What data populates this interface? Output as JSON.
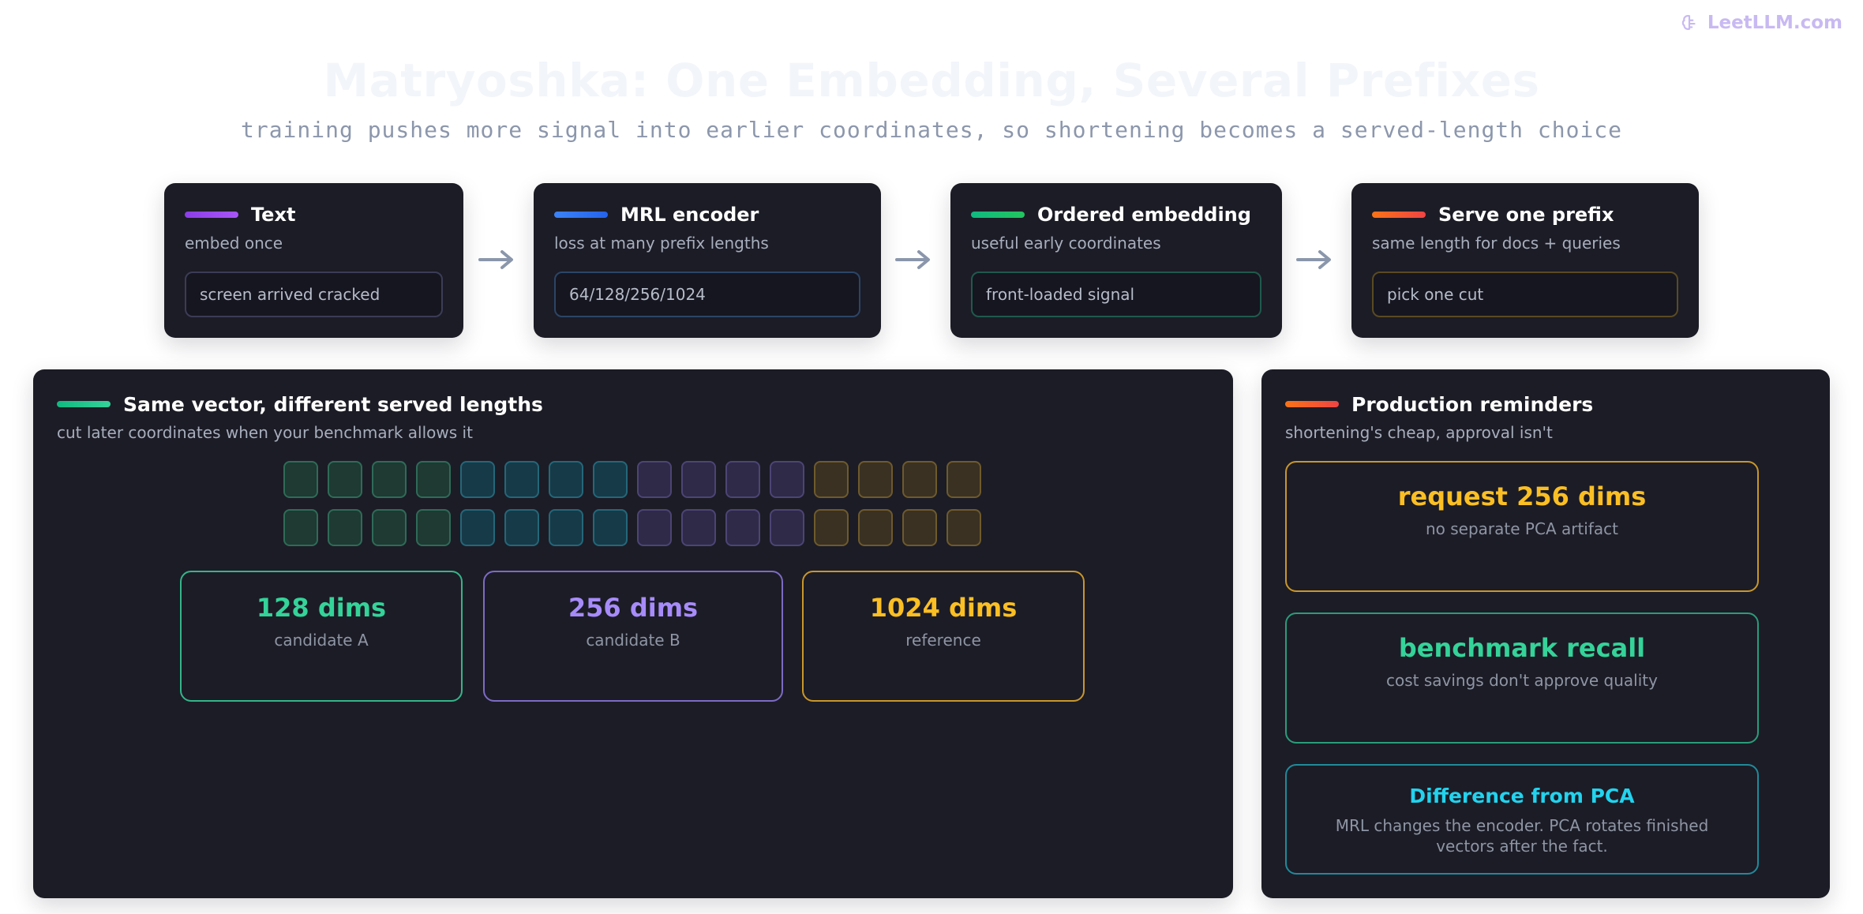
{
  "brand": {
    "name": "LeetLLM.com"
  },
  "title": "Matryoshka: One Embedding, Several Prefixes",
  "subtitle": "training pushes more signal into earlier coordinates, so shortening becomes a served-length choice",
  "pipeline": [
    {
      "title": "Text",
      "subtitle": "embed once",
      "box": "screen arrived cracked",
      "accent": "#8b3ee6",
      "accent2": "#a855f7"
    },
    {
      "title": "MRL encoder",
      "subtitle": "loss at many prefix lengths",
      "box": "64/128/256/1024",
      "accent": "#3b82f6",
      "accent2": "#2563eb"
    },
    {
      "title": "Ordered embedding",
      "subtitle": "useful early coordinates",
      "box": "front-loaded signal",
      "accent": "#10b981",
      "accent2": "#22c55e"
    },
    {
      "title": "Serve one prefix",
      "subtitle": "same length for docs + queries",
      "box": "pick one cut",
      "accent": "#f97316",
      "accent2": "#ef4444"
    }
  ],
  "left_panel": {
    "title": "Same vector, different served lengths",
    "subtitle": "cut later coordinates when your benchmark allows it",
    "accent": "#10b981",
    "dims": [
      {
        "value": "128 dims",
        "label": "candidate A",
        "color": "#34d399",
        "border": "#34b58a"
      },
      {
        "value": "256 dims",
        "label": "candidate B",
        "color": "#a78bfa",
        "border": "#7d6bc4"
      },
      {
        "value": "1024 dims",
        "label": "reference",
        "color": "#fbbf24",
        "border": "#c9972a"
      }
    ]
  },
  "right_panel": {
    "title": "Production reminders",
    "subtitle": "shortening's cheap, approval isn't",
    "accent": "#f97316",
    "items": [
      {
        "value": "request 256 dims",
        "label": "no separate PCA artifact",
        "color": "#fbbf24",
        "border": "#c9972a"
      },
      {
        "value": "benchmark recall",
        "label": "cost savings don't approve quality",
        "color": "#34d399",
        "border": "#2a9c7a"
      },
      {
        "value": "Difference from PCA",
        "label": "MRL changes the encoder. PCA rotates finished vectors after the fact.",
        "color": "#22d3ee",
        "border": "#1f8a9a"
      }
    ]
  }
}
